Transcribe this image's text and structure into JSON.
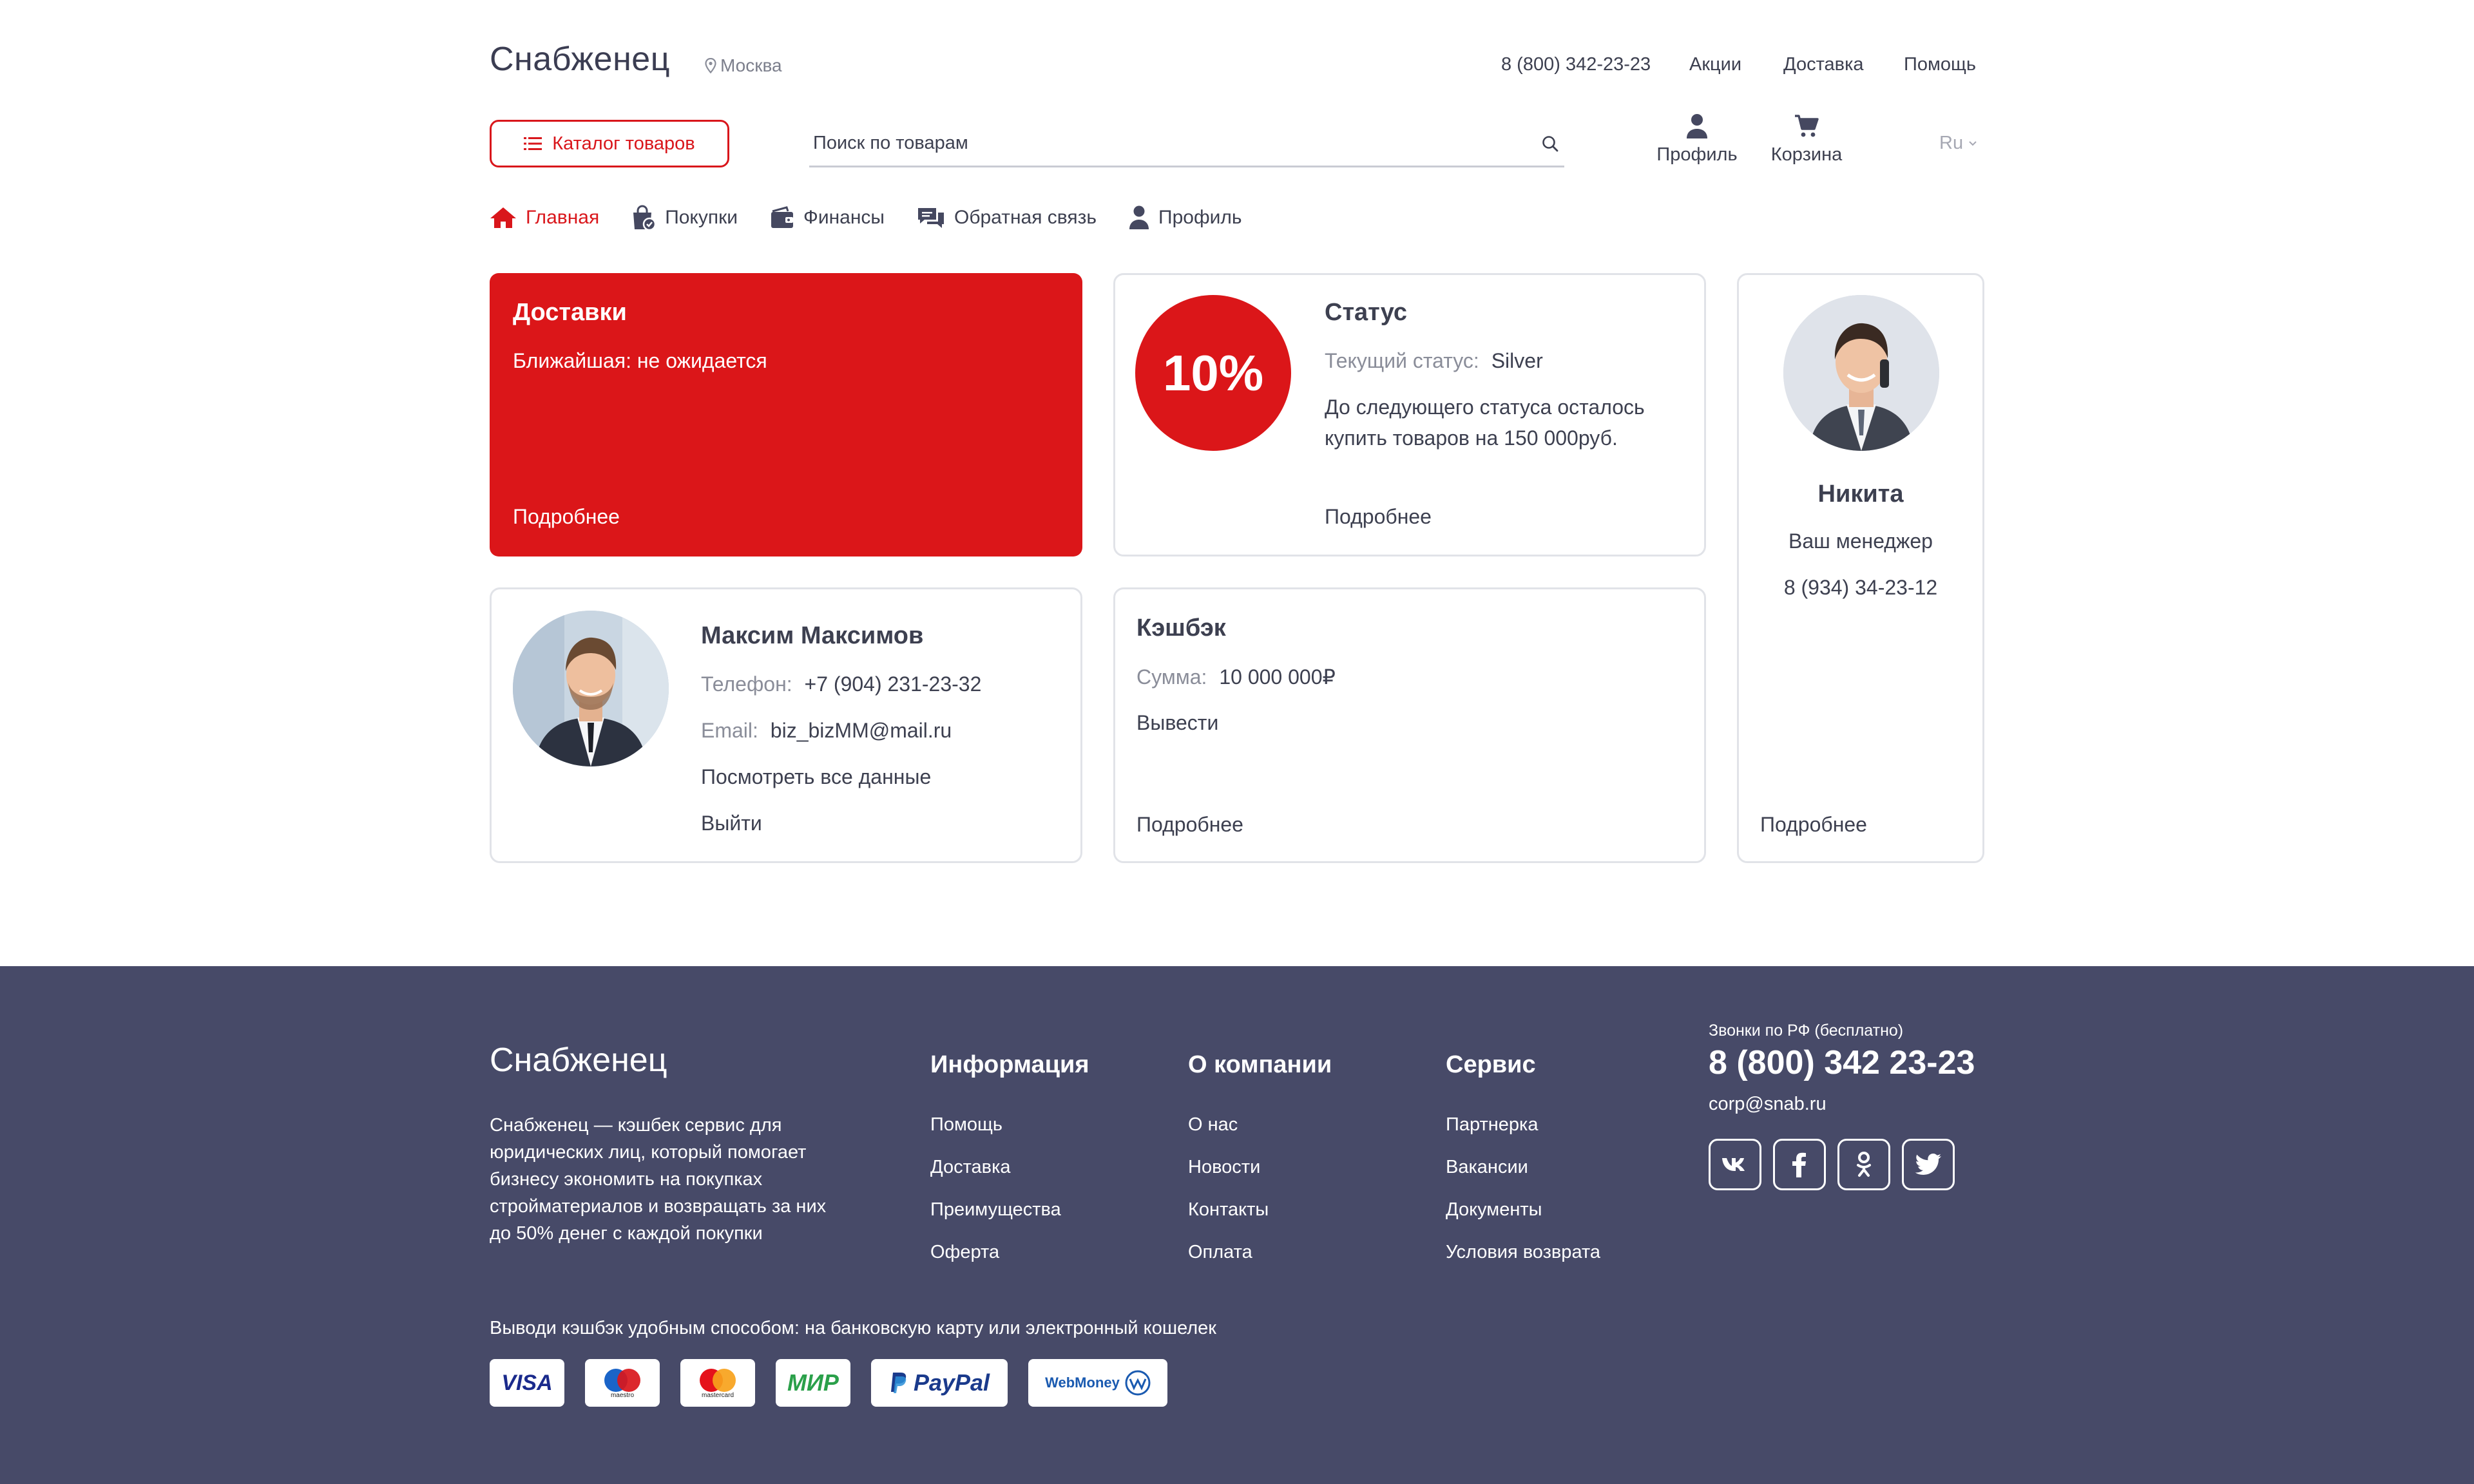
{
  "header": {
    "logo": "Снабженец",
    "city": "Москва",
    "phone": "8 (800) 342-23-23",
    "nav": [
      "Акции",
      "Доставка",
      "Помощь"
    ],
    "catalog_label": "Каталог товаров",
    "search_placeholder": "Поиск по товарам",
    "profile_label": "Профиль",
    "cart_label": "Корзина",
    "lang": "Ru"
  },
  "tabs": [
    {
      "label": "Главная",
      "icon": "home-icon",
      "active": true
    },
    {
      "label": "Покупки",
      "icon": "shopping-bag-icon"
    },
    {
      "label": "Финансы",
      "icon": "wallet-icon"
    },
    {
      "label": "Обратная связь",
      "icon": "chat-icon"
    },
    {
      "label": "Профиль",
      "icon": "user-icon"
    }
  ],
  "cards": {
    "delivery": {
      "title": "Доставки",
      "text": "Ближайшая: не ожидается",
      "more": "Подробнее"
    },
    "status": {
      "badge": "10%",
      "title": "Статус",
      "current_label": "Текущий статус:",
      "current_value": "Silver",
      "next_line1": "До следующего статуса осталось",
      "next_line2": "купить товаров на 150 000руб.",
      "more": "Подробнее"
    },
    "manager": {
      "name": "Никита",
      "role": "Ваш менеджер",
      "phone": "8 (934) 34-23-12",
      "more": "Подробнее"
    },
    "user": {
      "name": "Максим Максимов",
      "phone_label": "Телефон:",
      "phone_value": "+7 (904) 231-23-32",
      "email_label": "Email:",
      "email_value": "biz_bizMM@mail.ru",
      "view_all": "Посмотреть все данные",
      "logout": "Выйти"
    },
    "cashback": {
      "title": "Кэшбэк",
      "sum_label": "Сумма:",
      "sum_value": "10 000 000₽",
      "withdraw": "Вывести",
      "more": "Подробнее"
    }
  },
  "footer": {
    "logo": "Снабженец",
    "description": "Снабженец — кэшбек сервис для юридических лиц, который помогает бизнесу экономить на покупках стройматериалов и возвращать за них до 50% денег с каждой покупки",
    "columns": [
      {
        "title": "Информация",
        "links": [
          "Помощь",
          "Доставка",
          "Преимущества",
          "Оферта"
        ]
      },
      {
        "title": "О компании",
        "links": [
          "О нас",
          "Новости",
          "Контакты",
          "Оплата"
        ]
      },
      {
        "title": "Сервис",
        "links": [
          "Партнерка",
          "Вакансии",
          "Документы",
          "Условия возврата"
        ]
      }
    ],
    "calls_label": "Звонки по РФ (бесплатно)",
    "phone": "8 (800) 342 23-23",
    "email": "corp@snab.ru",
    "social": [
      "vk-icon",
      "facebook-icon",
      "odnoklassniki-icon",
      "twitter-icon"
    ],
    "cashback_text": "Выводи кэшбэк удобным способом: на банковскую карту или электронный кошелек",
    "payments": {
      "visa": "VISA",
      "maestro": "maestro",
      "mastercard": "mastercard",
      "mir": "МИР",
      "paypal": "PayPal",
      "webmoney": "WebMoney"
    }
  },
  "colors": {
    "accent": "#db1619",
    "footer_bg": "#474a68",
    "text": "#3d4050",
    "muted": "#8a8d99"
  }
}
